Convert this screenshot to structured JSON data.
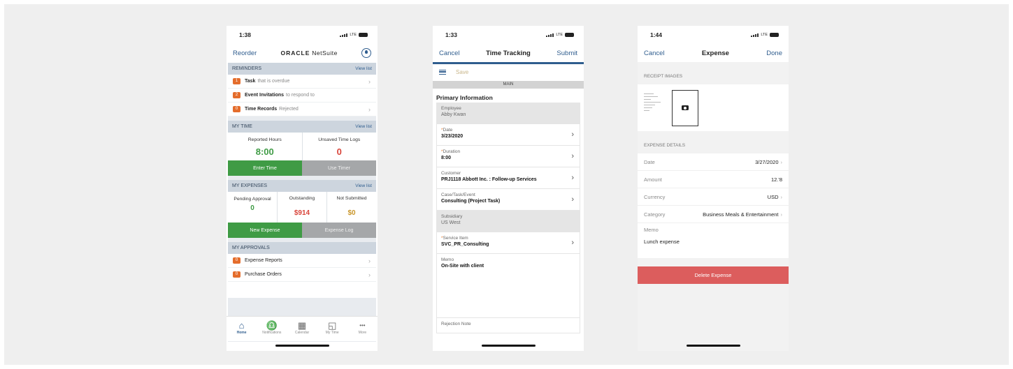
{
  "home": {
    "time": "1:38",
    "network": "LTE",
    "nav": {
      "left": "Reorder",
      "brand_bold": "ORACLE",
      "brand_rest": " NetSuite"
    },
    "reminders": {
      "title": "REMINDERS",
      "link": "View list",
      "items": [
        {
          "count": "1",
          "bold": "Task",
          "rest": "that is overdue"
        },
        {
          "count": "2",
          "bold": "Event Invitations",
          "rest": "to respond to"
        },
        {
          "count": "0",
          "bold": "Time Records",
          "rest": "Rejected"
        }
      ]
    },
    "my_time": {
      "title": "MY TIME",
      "link": "View list",
      "reported_label": "Reported Hours",
      "reported_value": "8:00",
      "unsaved_label": "Unsaved Time Logs",
      "unsaved_value": "0",
      "enter_label": "Enter Time",
      "timer_label": "Use Timer"
    },
    "my_expenses": {
      "title": "MY EXPENSES",
      "link": "View list",
      "pending_label": "Pending Approval",
      "pending_value": "0",
      "outstanding_label": "Outstanding",
      "outstanding_value": "$914",
      "notsub_label": "Not Submitted",
      "notsub_value": "$0",
      "new_label": "New Expense",
      "log_label": "Expense Log"
    },
    "my_approvals": {
      "title": "MY APPROVALS",
      "items": [
        {
          "count": "0",
          "label": "Expense Reports"
        },
        {
          "count": "0",
          "label": "Purchase Orders"
        }
      ]
    },
    "tabs": [
      {
        "label": "Home",
        "icon": "home-icon"
      },
      {
        "label": "Notifications",
        "icon": "bell-icon"
      },
      {
        "label": "Calendar",
        "icon": "calendar-icon"
      },
      {
        "label": "My Time",
        "icon": "clock-icon"
      },
      {
        "label": "More",
        "icon": "more-icon"
      }
    ]
  },
  "time_tracking": {
    "time": "1:33",
    "network": "LTE",
    "nav": {
      "left": "Cancel",
      "title": "Time Tracking",
      "right": "Submit"
    },
    "save": "Save",
    "main": "MAIN",
    "section": "Primary Information",
    "fields": [
      {
        "label": "Employee",
        "value": "Abby Kwan",
        "required": false,
        "readonly": true
      },
      {
        "label": "Date",
        "value": "3/23/2020",
        "required": true,
        "readonly": false
      },
      {
        "label": "Duration",
        "value": "8:00",
        "required": true,
        "readonly": false
      },
      {
        "label": "Customer",
        "value": "PRJ1118 Abbott Inc. : Follow-up Services",
        "required": false,
        "readonly": false
      },
      {
        "label": "Case/Task/Event",
        "value": "Consulting (Project Task)",
        "required": false,
        "readonly": false
      },
      {
        "label": "Subsidiary",
        "value": "US West",
        "required": false,
        "readonly": true
      },
      {
        "label": "Service Item",
        "value": "SVC_PR_Consulting",
        "required": true,
        "readonly": false
      }
    ],
    "memo_label": "Memo",
    "memo_value": "On-Site with client",
    "rejection_label": "Rejection Note"
  },
  "expense": {
    "time": "1:44",
    "network": "LTE",
    "nav": {
      "left": "Cancel",
      "title": "Expense",
      "right": "Done"
    },
    "receipts_title": "RECEIPT IMAGES",
    "details_title": "EXPENSE DETAILS",
    "rows": [
      {
        "key": "Date",
        "value": "3/27/2020"
      },
      {
        "key": "Amount",
        "value": "12.'8"
      },
      {
        "key": "Currency",
        "value": "USD"
      },
      {
        "key": "Category",
        "value": "Business Meals & Entertainment"
      }
    ],
    "memo_key": "Memo",
    "memo_value": "Lunch expense",
    "delete_label": "Delete Expense"
  }
}
